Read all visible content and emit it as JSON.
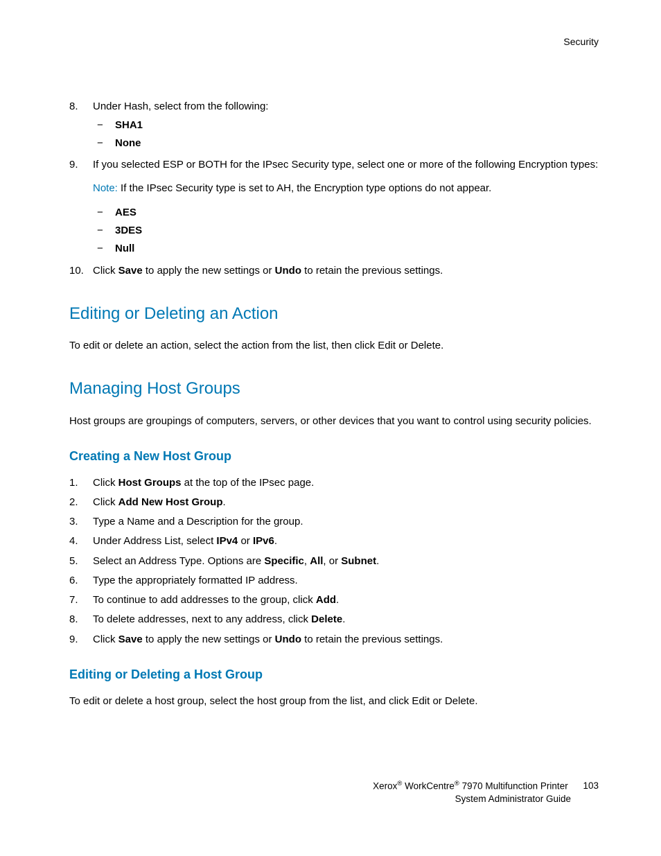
{
  "running_head": "Security",
  "step8": {
    "num": "8.",
    "text": "Under Hash, select from the following:",
    "items": [
      "SHA1",
      "None"
    ]
  },
  "step9": {
    "num": "9.",
    "text": "If you selected ESP or BOTH for the IPsec Security type, select one or more of the following Encryption types:",
    "note_label": "Note:",
    "note_text": " If the IPsec Security type is set to AH, the Encryption type options do not appear.",
    "items": [
      "AES",
      "3DES",
      "Null"
    ]
  },
  "step10": {
    "num": "10.",
    "pre1": "Click ",
    "b1": "Save",
    "mid": " to apply the new settings or ",
    "b2": "Undo",
    "post": " to retain the previous settings."
  },
  "sec_edit_action": {
    "heading": "Editing or Deleting an Action",
    "para": "To edit or delete an action, select the action from the list, then click Edit or Delete."
  },
  "sec_manage": {
    "heading": "Managing Host Groups",
    "para": "Host groups are groupings of computers, servers, or other devices that you want to control using security policies."
  },
  "sec_create": {
    "heading": "Creating a New Host Group",
    "steps": [
      {
        "num": "1.",
        "segs": [
          {
            "t": "Click "
          },
          {
            "t": "Host Groups",
            "b": true
          },
          {
            "t": " at the top of the IPsec page."
          }
        ]
      },
      {
        "num": "2.",
        "segs": [
          {
            "t": "Click "
          },
          {
            "t": "Add New Host Group",
            "b": true
          },
          {
            "t": "."
          }
        ]
      },
      {
        "num": "3.",
        "segs": [
          {
            "t": "Type a Name and a Description for the group."
          }
        ]
      },
      {
        "num": "4.",
        "segs": [
          {
            "t": "Under Address List, select "
          },
          {
            "t": "IPv4",
            "b": true
          },
          {
            "t": " or "
          },
          {
            "t": "IPv6",
            "b": true
          },
          {
            "t": "."
          }
        ]
      },
      {
        "num": "5.",
        "segs": [
          {
            "t": "Select an Address Type. Options are "
          },
          {
            "t": "Specific",
            "b": true
          },
          {
            "t": ", "
          },
          {
            "t": "All",
            "b": true
          },
          {
            "t": ", or "
          },
          {
            "t": "Subnet",
            "b": true
          },
          {
            "t": "."
          }
        ]
      },
      {
        "num": "6.",
        "segs": [
          {
            "t": "Type the appropriately formatted IP address."
          }
        ]
      },
      {
        "num": "7.",
        "segs": [
          {
            "t": "To continue to add addresses to the group, click "
          },
          {
            "t": "Add",
            "b": true
          },
          {
            "t": "."
          }
        ]
      },
      {
        "num": "8.",
        "segs": [
          {
            "t": "To delete addresses, next to any address, click "
          },
          {
            "t": "Delete",
            "b": true
          },
          {
            "t": "."
          }
        ]
      },
      {
        "num": "9.",
        "segs": [
          {
            "t": "Click "
          },
          {
            "t": "Save",
            "b": true
          },
          {
            "t": " to apply the new settings or "
          },
          {
            "t": "Undo",
            "b": true
          },
          {
            "t": " to retain the previous settings."
          }
        ]
      }
    ]
  },
  "sec_edit_host": {
    "heading": "Editing or Deleting a Host Group",
    "para": "To edit or delete a host group, select the host group from the list, and click Edit or Delete."
  },
  "footer": {
    "brand1": "Xerox",
    "brand2": "WorkCentre",
    "model": " 7970 Multifunction Printer",
    "page_num": "103",
    "line2": "System Administrator Guide"
  }
}
